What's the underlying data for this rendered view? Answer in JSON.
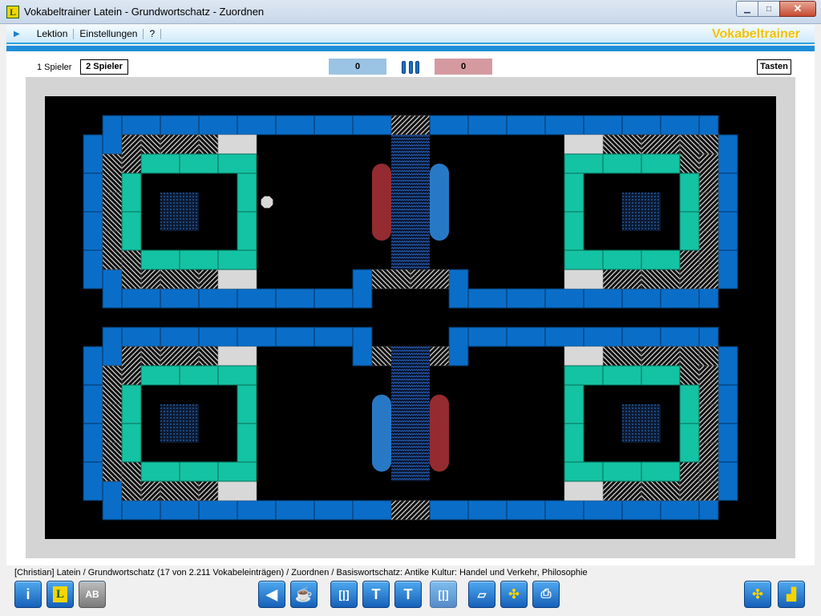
{
  "window": {
    "title": "Vokabeltrainer Latein - Grundwortschatz - Zuordnen",
    "minimize": "▁",
    "maximize": "□",
    "close": "✕"
  },
  "menu": {
    "items": [
      "Lektion",
      "Einstellungen",
      "?"
    ],
    "brand": "Vokabeltrainer"
  },
  "game": {
    "players_one": "1 Spieler",
    "players_two": "2 Spieler",
    "score_left": "0",
    "score_right": "0",
    "keys_button": "Tasten"
  },
  "status": {
    "text": "[Christian]  Latein / Grundwortschatz  (17 von 2.211 Vokabeleinträgen) / Zuordnen / Basiswortschatz: Antike Kultur: Handel und Verkehr, Philosophie"
  },
  "toolbar": {
    "info": "i",
    "lang": "L",
    "ab": "AB"
  },
  "colors": {
    "wall_blue": "#0a6ec9",
    "teal": "#14c3a3",
    "paddle_red": "#9c2d33",
    "paddle_blue": "#2a7fd0",
    "light_gray": "#d8d8d8"
  }
}
